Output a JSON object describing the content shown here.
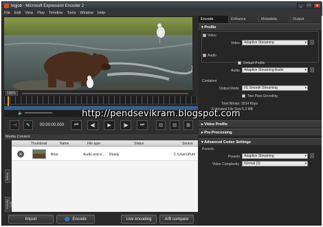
{
  "window": {
    "title": "bigjob - Microsoft Expression Encoder 2",
    "minimize": "_",
    "maximize": "□",
    "close": "✕"
  },
  "menu": [
    "File",
    "Edit",
    "View",
    "Play",
    "Timeline",
    "Tools",
    "Window",
    "Help"
  ],
  "preview": {
    "zoom": "100%"
  },
  "transport": {
    "timecode": "00:00:00.000",
    "prev_label": "⏮",
    "step_back_label": "◀|",
    "play_label": "▶",
    "step_fwd_label": "|▶",
    "next_label": "⏭"
  },
  "media_content": {
    "header": "Media Content",
    "side_tabs": [
      "Items",
      "Activity Log"
    ],
    "columns": [
      "Thumbnail",
      "Name",
      "File type",
      "Status",
      "Source"
    ],
    "rows": [
      {
        "remove": "✕",
        "name": "Bear",
        "file_type": "Audio and vi...",
        "status": "Ready",
        "source": "C:\\Users\\Publ"
      }
    ],
    "buttons": {
      "import": "Import",
      "encode": "Encode",
      "live_encoding": "Live encoding",
      "ab_compare": "A/B compare"
    }
  },
  "right_panel": {
    "tabs": [
      "Encode",
      "Enhance",
      "Metadata",
      "Output"
    ],
    "sections": {
      "profile": "Profile",
      "video_profile": "Video Profile",
      "pre_processing": "Pre-Processing",
      "advanced_codec": "Advanced Codec Settings"
    },
    "profile": {
      "video_group": "Video",
      "video_label": "Video",
      "video_value": "Adaptive Streaming",
      "audio_group": "Audio",
      "default_profile": "Default Profile",
      "audio_label": "Audio",
      "audio_value": "Adaptive Streaming Audio",
      "container_label": "Container",
      "output_mode_label": "Output Mode",
      "output_mode_value": "IIS Smooth Streaming",
      "two_pass": "Two Pass Encoding",
      "total_bitrate": "Total Bitrate: 3514 Kbps",
      "est_size": "Estimated File Size 5.3 MB"
    },
    "advanced": {
      "presets_group": "Presets",
      "presets_label": "Presets",
      "presets_value": "Adaptive Streaming",
      "complexity_label": "Video Complexity",
      "complexity_value": "Normal (3)"
    }
  },
  "watermark": "http://pendsevikram.blogspot.com"
}
